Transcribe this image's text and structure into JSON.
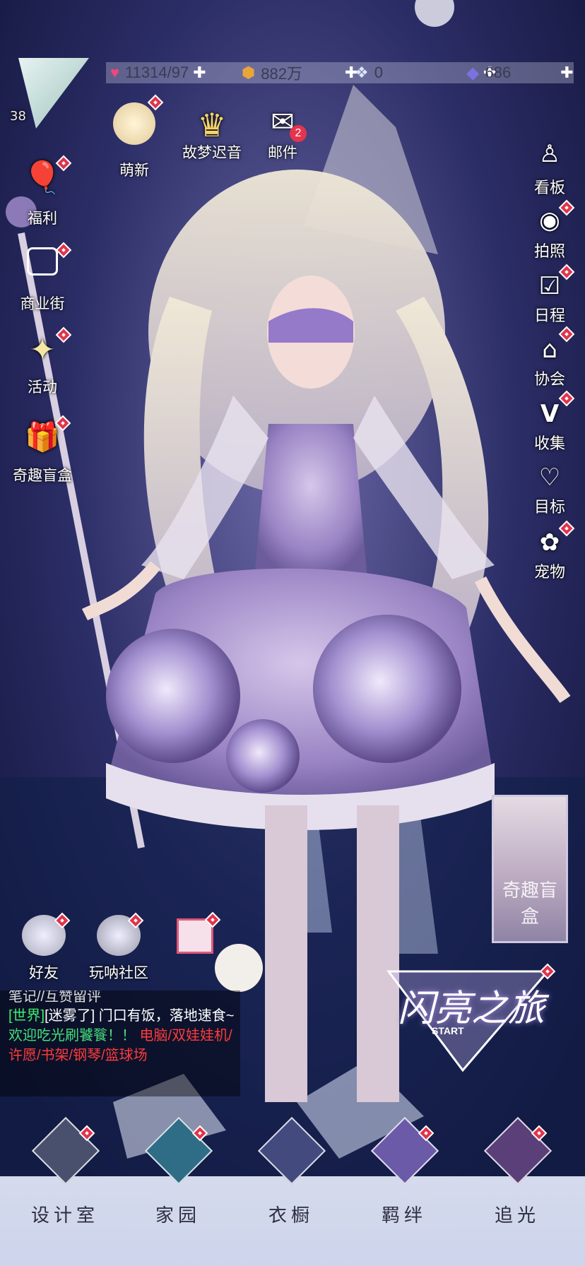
{
  "resources": {
    "stamina": "11314/97",
    "gold": "882万",
    "crystal": "0",
    "diamond": "686"
  },
  "player": {
    "level": "38"
  },
  "top_menu": {
    "mengxin": "萌新",
    "gumeng": "故梦迟音",
    "mail": "邮件",
    "mail_count": "2"
  },
  "left_menu": {
    "fuli": "福利",
    "shangyejie": "商业街",
    "huodong": "活动",
    "manghe": "奇趣盲盒"
  },
  "right_menu": {
    "kanban": "看板",
    "paizhao": "拍照",
    "richeng": "日程",
    "xiehui": "协会",
    "shouji": "收集",
    "mubiao": "目标",
    "chongwu": "宠物"
  },
  "social": {
    "friends": "好友",
    "community": "玩呐社区"
  },
  "banner": {
    "label": "奇趣盲盒"
  },
  "journey": {
    "title": "闪亮之旅",
    "sub": "START"
  },
  "chat": {
    "line0": "笔记//互赞留评",
    "channel": "[世界]",
    "user": "[迷雾了]",
    "msg_a": " 门口有饭，落地速食~",
    "msg_b": "欢迎吃光刷饕餮！！",
    "msg_c": " 电脑/双娃娃机/许愿/书架/钢琴/篮球场"
  },
  "bottom_nav": {
    "n1": "设计室",
    "n2": "家园",
    "n3": "衣橱",
    "n4": "羁绊",
    "n5": "追光"
  },
  "colors": {
    "bg": "#1d1f4a",
    "accent": "#e0344b",
    "chat_channel": "#3df06c",
    "chat_user": "#ffffff",
    "chat_green": "#45e07c",
    "chat_red": "#ff3b3b"
  }
}
